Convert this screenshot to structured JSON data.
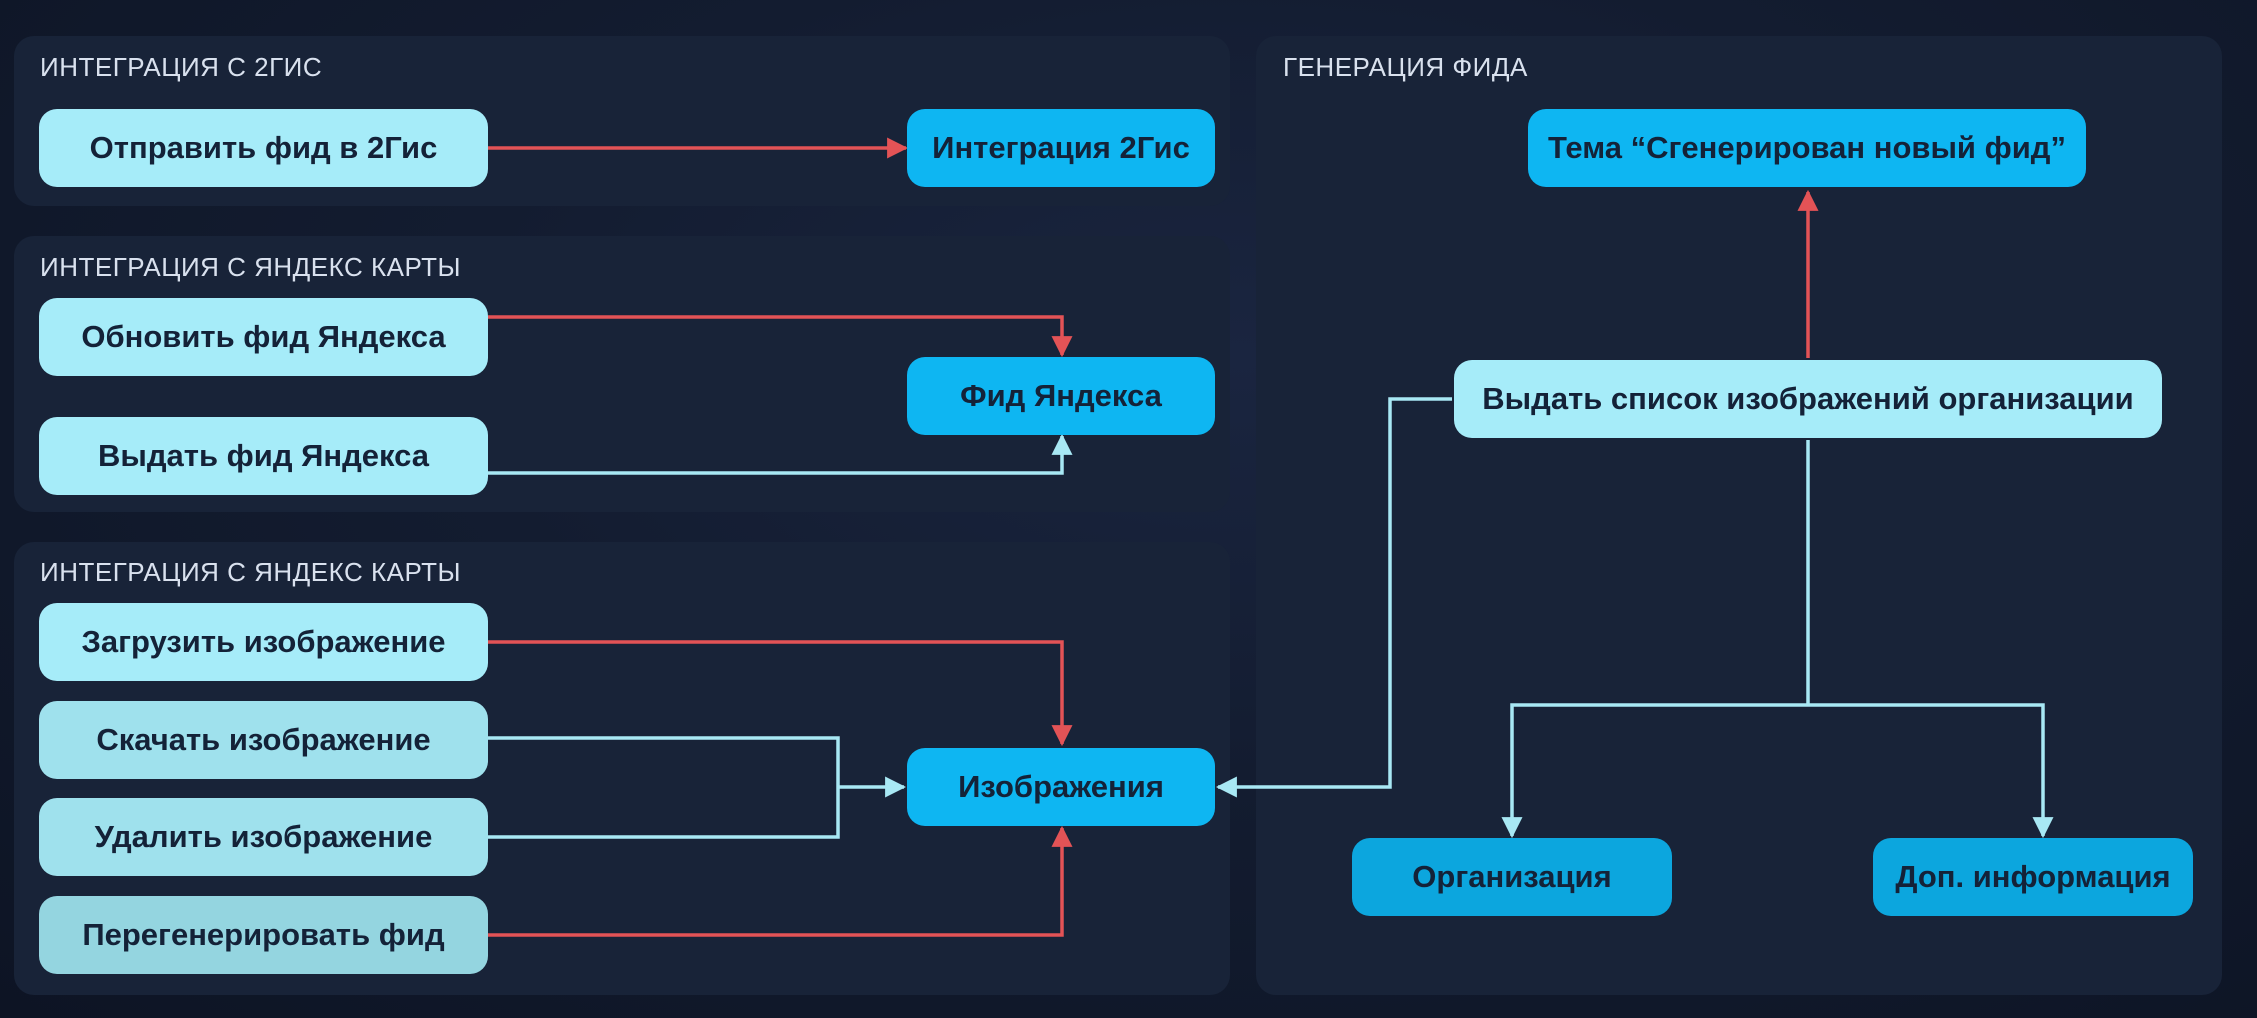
{
  "colors": {
    "background": "#131c30",
    "panel": "#182338",
    "red_arrow": "#e35356",
    "light_arrow": "#a8e8f4",
    "light_node": "#a6ecf9",
    "blue_node": "#0eb6f2",
    "title_text": "#d9e1ee"
  },
  "panels": {
    "integration_2gis": {
      "title": "ИНТЕГРАЦИЯ С 2ГИС"
    },
    "integration_yandex_maps": {
      "title": "ИНТЕГРАЦИЯ С ЯНДЕКС КАРТЫ"
    },
    "integration_yandex_images": {
      "title": "ИНТЕГРАЦИЯ С ЯНДЕКС КАРТЫ"
    },
    "feed_generation": {
      "title": "ГЕНЕРАЦИЯ ФИДА"
    }
  },
  "nodes": {
    "send_feed_2gis": "Отправить фид в 2Гис",
    "integration_2gis": "Интеграция 2Гис",
    "update_yandex_feed": "Обновить фид Яндекса",
    "issue_yandex_feed": "Выдать фид Яндекса",
    "yandex_feed": "Фид Яндекса",
    "upload_image": "Загрузить изображение",
    "download_image": "Скачать изображение",
    "delete_image": "Удалить изображение",
    "regenerate_feed": "Перегенерировать фид",
    "images": "Изображения",
    "topic_new_feed": "Тема “Сгенерирован новый фид”",
    "issue_org_images": "Выдать список изображений организации",
    "organization": "Организация",
    "extra_info": "Доп. информация"
  }
}
